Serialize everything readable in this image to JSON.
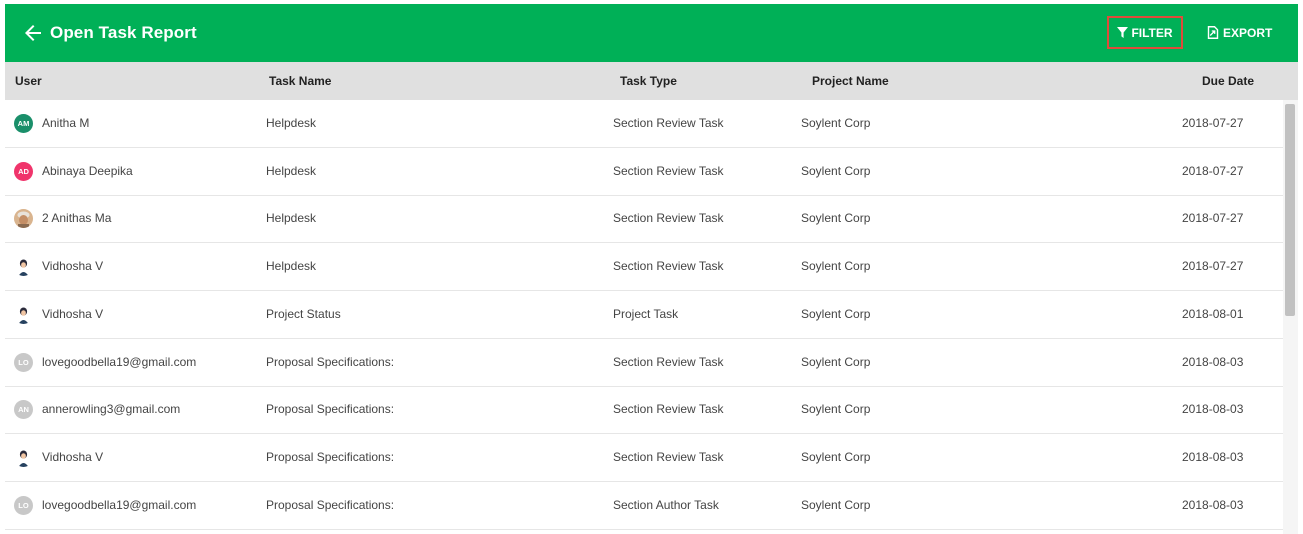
{
  "header": {
    "title": "Open Task Report",
    "back_icon": "arrow-left-icon",
    "filter_label": "FILTER",
    "export_label": "EXPORT",
    "background": "#00b057"
  },
  "columns": {
    "user": "User",
    "task_name": "Task Name",
    "task_type": "Task Type",
    "project_name": "Project Name",
    "due_date": "Due Date"
  },
  "rows": [
    {
      "initials": "AM",
      "avatar_color": "#1a8f6a",
      "avatar_type": "initials",
      "user": "Anitha M",
      "task_name": "Helpdesk",
      "task_type": "Section Review Task",
      "project_name": "Soylent Corp",
      "due_date": "2018-07-27"
    },
    {
      "initials": "AD",
      "avatar_color": "#f0346b",
      "avatar_type": "initials",
      "user": "Abinaya Deepika",
      "task_name": "Helpdesk",
      "task_type": "Section Review Task",
      "project_name": "Soylent Corp",
      "due_date": "2018-07-27"
    },
    {
      "initials": "",
      "avatar_color": "#e8c9a8",
      "avatar_type": "photo-elder",
      "user": "2 Anithas Ma",
      "task_name": "Helpdesk",
      "task_type": "Section Review Task",
      "project_name": "Soylent Corp",
      "due_date": "2018-07-27"
    },
    {
      "initials": "",
      "avatar_color": "#ffffff",
      "avatar_type": "photo-woman",
      "user": "Vidhosha V",
      "task_name": "Helpdesk",
      "task_type": "Section Review Task",
      "project_name": "Soylent Corp",
      "due_date": "2018-07-27"
    },
    {
      "initials": "",
      "avatar_color": "#ffffff",
      "avatar_type": "photo-woman",
      "user": "Vidhosha V",
      "task_name": "Project Status",
      "task_type": "Project Task",
      "project_name": "Soylent Corp",
      "due_date": "2018-08-01"
    },
    {
      "initials": "LO",
      "avatar_color": "#c8c8c8",
      "avatar_type": "initials",
      "user": "lovegoodbella19@gmail.com",
      "task_name": "Proposal Specifications:",
      "task_type": "Section Review Task",
      "project_name": "Soylent Corp",
      "due_date": "2018-08-03"
    },
    {
      "initials": "AN",
      "avatar_color": "#c8c8c8",
      "avatar_type": "initials",
      "user": "annerowling3@gmail.com",
      "task_name": "Proposal Specifications:",
      "task_type": "Section Review Task",
      "project_name": "Soylent Corp",
      "due_date": "2018-08-03"
    },
    {
      "initials": "",
      "avatar_color": "#ffffff",
      "avatar_type": "photo-woman",
      "user": "Vidhosha V",
      "task_name": "Proposal Specifications:",
      "task_type": "Section Review Task",
      "project_name": "Soylent Corp",
      "due_date": "2018-08-03"
    },
    {
      "initials": "LO",
      "avatar_color": "#c8c8c8",
      "avatar_type": "initials",
      "user": "lovegoodbella19@gmail.com",
      "task_name": "Proposal Specifications:",
      "task_type": "Section Author Task",
      "project_name": "Soylent Corp",
      "due_date": "2018-08-03"
    }
  ]
}
